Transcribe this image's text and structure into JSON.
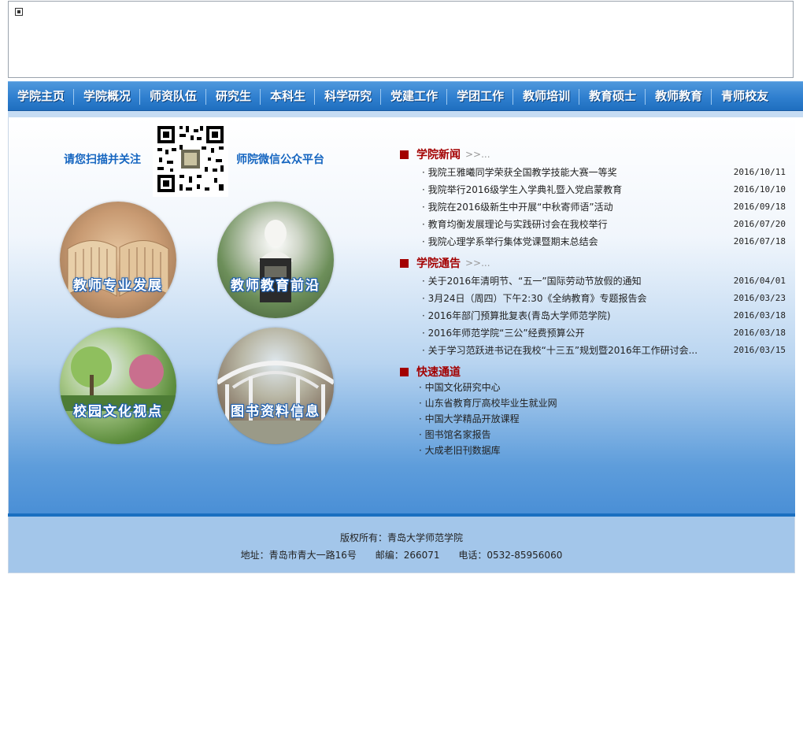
{
  "nav": {
    "items": [
      "学院主页",
      "学院概况",
      "师资队伍",
      "研究生",
      "本科生",
      "科学研究",
      "党建工作",
      "学团工作",
      "教师培训",
      "教育硕士",
      "教师教育",
      "青师校友"
    ]
  },
  "wechat": {
    "left_text": "请您扫描并关注",
    "right_text": "师院微信公众平台"
  },
  "features": [
    {
      "label": "教师专业发展"
    },
    {
      "label": "教师教育前沿"
    },
    {
      "label": "校园文化视点"
    },
    {
      "label": "图书资料信息"
    }
  ],
  "news": {
    "title": "学院新闻",
    "more": ">>...",
    "items": [
      {
        "text": "我院王雅曦同学荣获全国教学技能大赛一等奖",
        "date": "2016/10/11"
      },
      {
        "text": "我院举行2016级学生入学典礼暨入党启蒙教育",
        "date": "2016/10/10"
      },
      {
        "text": "我院在2016级新生中开展“中秋寄师语”活动",
        "date": "2016/09/18"
      },
      {
        "text": "教育均衡发展理论与实践研讨会在我校举行",
        "date": "2016/07/20"
      },
      {
        "text": "我院心理学系举行集体党课暨期末总结会",
        "date": "2016/07/18"
      }
    ]
  },
  "notices": {
    "title": "学院通告",
    "more": ">>...",
    "items": [
      {
        "text": "关于2016年清明节、“五一”国际劳动节放假的通知",
        "date": "2016/04/01"
      },
      {
        "text": "3月24日（周四）下午2:30《全纳教育》专题报告会",
        "date": "2016/03/23"
      },
      {
        "text": "2016年部门预算批复表(青岛大学师范学院)",
        "date": "2016/03/18"
      },
      {
        "text": "2016年师范学院“三公”经费预算公开",
        "date": "2016/03/18"
      },
      {
        "text": "关于学习范跃进书记在我校“十三五”规划暨2016年工作研讨会...",
        "date": "2016/03/15"
      }
    ]
  },
  "quick": {
    "title": "快速通道",
    "items": [
      "中国文化研究中心",
      "山东省教育厅高校毕业生就业网",
      "中国大学精品开放课程",
      "图书馆名家报告",
      "大成老旧刊数据库"
    ]
  },
  "footer": {
    "copyright": "版权所有：青岛大学师范学院",
    "address": "地址：青岛市青大一路16号",
    "postcode": "邮编：266071",
    "phone": "电话：0532-85956060"
  }
}
